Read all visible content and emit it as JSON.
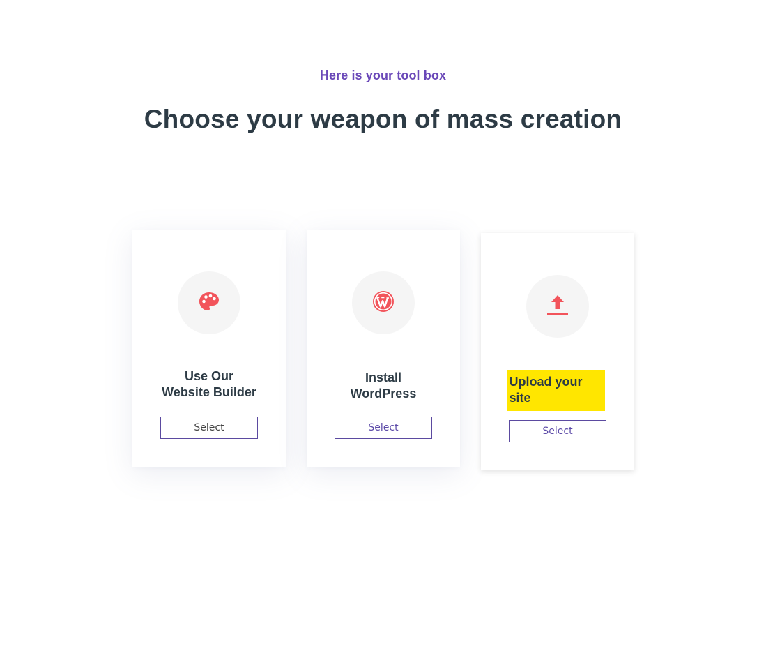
{
  "header": {
    "eyebrow": "Here is your tool box",
    "headline": "Choose your weapon of mass creation"
  },
  "cards": [
    {
      "icon": "palette-icon",
      "title_lines": [
        "Use Our",
        "Website Builder"
      ],
      "button_label": "Select"
    },
    {
      "icon": "wordpress-icon",
      "title_lines": [
        "Install",
        "WordPress"
      ],
      "button_label": "Select"
    },
    {
      "icon": "upload-icon",
      "title_lines": [
        "Upload your site"
      ],
      "button_label": "Select"
    }
  ],
  "colors": {
    "accent": "#6a48b8",
    "heading": "#2d3b45",
    "icon": "#f2545b",
    "highlight": "#ffe600",
    "icon_bg": "#f5f5f5"
  }
}
